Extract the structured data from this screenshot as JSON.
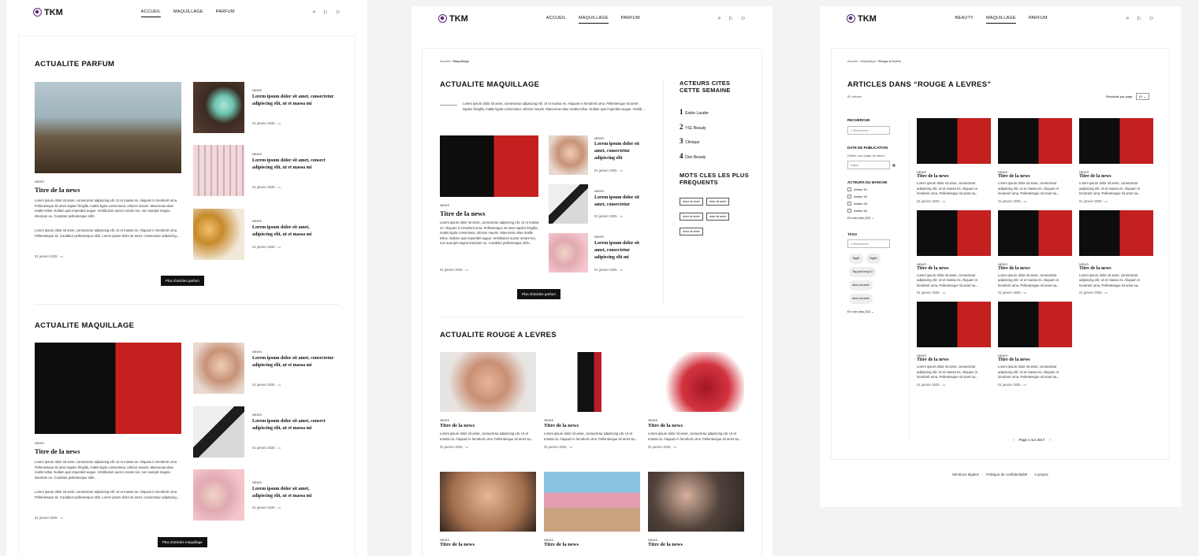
{
  "brand": "TKM",
  "frame_titles": {
    "f2": "Page catégorie V2",
    "f3": "Page de résultats d'une sous-catégorie"
  },
  "f1": {
    "nav": [
      "ACCUEIL",
      "MAQUILLAGE",
      "PARFUM"
    ],
    "sec1_title": "ACTUALITE PARFUM",
    "main": {
      "tag": "NEWS",
      "title": "Titre de la news",
      "text": "Lorem ipsum dolor sit amet, consectetur adipiscing elit. Ut et massa mi. Aliquam in hendrerit urna. Pellentesque sit amet sapien fringilla, mattis ligula consectetur, ultrices mauris. Maecenas vitae mattis tellus. Nullam quis imperdiet augue. Vestibulum auctor ornare leo, non suscipit magna interdum eu. Curabitur pellentesque nibh.",
      "text2": "Lorem ipsum dolor sit amet, consectetur adipiscing elit. Ut et massa mi. Aliquam in hendrerit urna. Pellentesque sit. Curabitur pellentesque nibh. Lorem ipsum dolor sit amet, consectetur adipiscing...",
      "date": "01 janvier 2025"
    },
    "side": [
      {
        "tag": "NEWS",
        "title": "Lorem ipsum dolor sit amet, consectetur adipiscing elit, ut et massa mi",
        "date": "01 janvier 2025"
      },
      {
        "tag": "NEWS",
        "title": "Lorem ipsum dolor sit amet, consect adipiscing elit, ut et massa mi",
        "date": "01 janvier 2025"
      },
      {
        "tag": "NEWS",
        "title": "Lorem ipsum dolor sit amet, adipiscing elit, ut et massa mi",
        "date": "01 janvier 2025"
      }
    ],
    "btn1": "Plus d'articles parfum",
    "sec2_title": "ACTUALITE MAQUILLAGE",
    "main2": {
      "tag": "NEWS",
      "title": "Titre de la news",
      "date": "01 janvier 2025"
    },
    "side2": [
      {
        "tag": "NEWS",
        "title": "Lorem ipsum dolor sit amet, consectetur adipiscing elit, ut et massa mi",
        "date": "01 janvier 2025"
      },
      {
        "tag": "NEWS",
        "title": "Lorem ipsum dolor sit amet, consect adipiscing elit, ut et massa mi",
        "date": "01 janvier 2025"
      },
      {
        "tag": "NEWS",
        "title": "Lorem ipsum dolor sit amet, adipiscing elit, ut et massa mi",
        "date": "01 janvier 2025"
      }
    ],
    "btn2": "Plus d'articles maquillage"
  },
  "f2": {
    "nav": [
      "ACCUEIL",
      "MAQUILLAGE",
      "PARFUM"
    ],
    "crumb": [
      "Accueil",
      "Maquillage"
    ],
    "title": "ACTUALITE MAQUILLAGE",
    "intro": "Lorem ipsum dolor sit amet, consectetur adipiscing elit. Ut et massa mi. Aliquam in hendrerit urna. Pellentesque sit amet sapien fringilla, mattis ligula consectetur, ultrices mauris. Maecenas vitae mattis tellus. Nullam quis imperdiet augue. Vestib...",
    "main": {
      "tag": "NEWS",
      "title": "Titre de la news",
      "text": "Lorem ipsum dolor sit amet, consectetur adipiscing elit. Ut et massa mi. Aliquam in hendrerit urna. Pellentesque sit amet sapien fringilla, mattis ligula consectetur, ultrices mauris. Maecenas vitae mattis tellus. Nullam quis imperdiet augue. Vestibulum auctor ornare leo, non suscipit magna interdum eu. Curabitur pellentesque nibh...",
      "date": "01 janvier 2025"
    },
    "side": [
      {
        "tag": "NEWS",
        "title": "Lorem ipsum dolor sit amet, consectetur adipiscing elit",
        "date": "01 janvier 2025"
      },
      {
        "tag": "NEWS",
        "title": "Lorem ipsum dolor sit amet, consectetur",
        "date": "01 janvier 2025"
      },
      {
        "tag": "NEWS",
        "title": "Lorem ipsum dolor sit amet, consectetur adipiscing elit mi",
        "date": "01 janvier 2025"
      }
    ],
    "btn": "Plus d'articles parfum",
    "aside_title": "ACTEURS CITES CETTE SEMAINE",
    "actors": [
      "Estée Lauder",
      "YSL Beauty",
      "Clinique",
      "Dior Beauty"
    ],
    "kw_title": "MOTS CLES LES PLUS FREQUENTS",
    "keywords": [
      "dolor sit amet",
      "dolor sit amet",
      "dolor sit amet",
      "dolor sit amet",
      "dolor sit amet"
    ],
    "sec2_title": "ACTUALITE ROUGE A LEVRES",
    "cards": [
      {
        "tag": "NEWS",
        "title": "Titre de la news",
        "text": "Lorem ipsum dolor sit amet, consectetur adipiscing elit. Ut et massa mi. Aliquam in hendrerit urna. Pellentesque sit amet sa...",
        "date": "01 janvier 2025"
      },
      {
        "tag": "NEWS",
        "title": "Titre de la news",
        "text": "Lorem ipsum dolor sit amet, consectetur adipiscing elit. Ut et massa mi. Aliquam in hendrerit urna. Pellentesque sit amet sa...",
        "date": "01 janvier 2025"
      },
      {
        "tag": "NEWS",
        "title": "Titre de la news",
        "text": "Lorem ipsum dolor sit amet, consectetur adipiscing elit. Ut et massa mi. Aliquam in hendrerit urna. Pellentesque sit amet sa...",
        "date": "01 janvier 2025"
      },
      {
        "tag": "NEWS",
        "title": "Titre de la news"
      },
      {
        "tag": "NEWS",
        "title": "Titre de la news"
      },
      {
        "tag": "NEWS",
        "title": "Titre de la news"
      }
    ]
  },
  "f3": {
    "nav": [
      "BEAUTY",
      "MAQUILLAGE",
      "PARFUM"
    ],
    "crumb": [
      "Accueil",
      "Maquillage",
      "Rouge à levres"
    ],
    "title": "ARTICLES DANS “ROUGE A LEVRES”",
    "count": "82 articles",
    "per_page_label": "Résultats par page",
    "per_page": "10",
    "filters": {
      "search_title": "RECHERCHE",
      "search_ph": "Recherche",
      "date_title": "DATE DE PUBLICATION",
      "date_help": "Définir une plage de dates :",
      "date_ph": "Dates",
      "actors_title": "ACTEURS DU MARCHE",
      "actors": [
        "Acteur #1",
        "Acteur #2",
        "Acteur #3",
        "Acteur #4"
      ],
      "more1": "En voir plus (32)",
      "tags_title": "TAGS",
      "tags_ph": "Recherche",
      "tags": [
        "Tag#1",
        "Tag#2",
        "Tag plus long #1",
        "dolor sit amet",
        "dolor sit amet"
      ],
      "more2": "En voir plus (32)"
    },
    "card": {
      "tag": "NEWS",
      "title": "Titre de la news",
      "text": "Lorem ipsum dolor sit amet, consectetur adipiscing elit. Ut et massa mi. Aliquam in hendrerit urna. Pellentesque sit amet sa...",
      "date": "01 janvier 2025"
    },
    "pager": "Page 1 sur 2017",
    "footer": [
      "Mentions légales",
      "Politique de confidentialité",
      "A propos"
    ]
  }
}
